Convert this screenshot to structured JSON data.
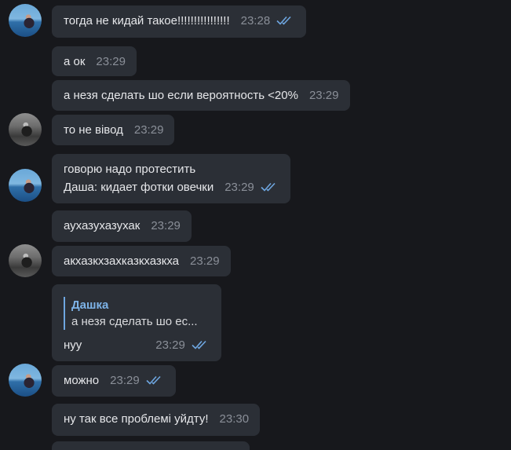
{
  "colors": {
    "background": "#17181c",
    "bubble": "#2b2f36",
    "text": "#e6e7ea",
    "time": "#8a8f98",
    "read_ticks": "#6ea6e0",
    "reply_name": "#7db3e8"
  },
  "messages": [
    {
      "text": "тогда не кидай такое!!!!!!!!!!!!!!!!",
      "time": "23:28",
      "status": "read"
    },
    {
      "text": "а ок",
      "time": "23:29"
    },
    {
      "text": "а незя сделать шо если вероятность <20%",
      "time": "23:29"
    },
    {
      "text": "то не вівод",
      "time": "23:29"
    },
    {
      "line1": "говорю надо протестить",
      "line2": "Даша: кидает фотки овечки",
      "time": "23:29",
      "status": "read"
    },
    {
      "text": "аухазухазухак",
      "time": "23:29"
    },
    {
      "text": "акхазкхзахказкхазкха",
      "time": "23:29"
    },
    {
      "reply_name": "Дашка",
      "reply_text": "а незя сделать шо ес...",
      "text": "нуу",
      "time": "23:29",
      "status": "read"
    },
    {
      "text": "можно",
      "time": "23:29",
      "status": "read"
    },
    {
      "text": "ну так все проблемі уйдту!",
      "time": "23:30"
    }
  ],
  "icons": {
    "read_status": "double-check-icon",
    "avatar_self": "avatar-seaside-photo",
    "avatar_other": "avatar-bw-photo"
  }
}
